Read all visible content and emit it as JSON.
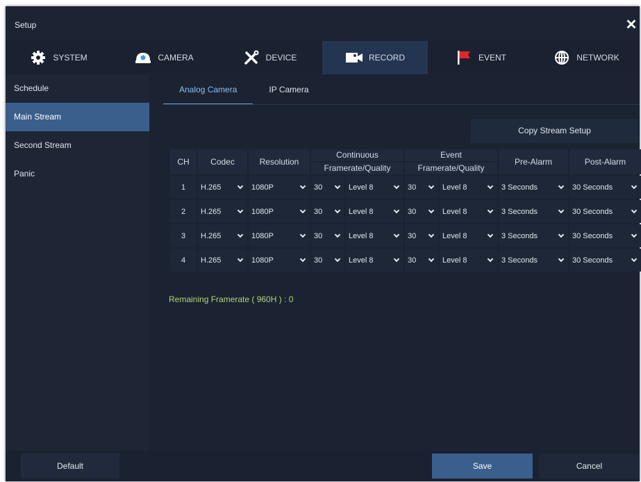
{
  "window": {
    "title": "Setup"
  },
  "tabs": [
    {
      "label": "SYSTEM",
      "icon": "gear-icon"
    },
    {
      "label": "CAMERA",
      "icon": "camera-icon"
    },
    {
      "label": "DEVICE",
      "icon": "tools-icon"
    },
    {
      "label": "RECORD",
      "icon": "video-camera-icon"
    },
    {
      "label": "EVENT",
      "icon": "flag-icon"
    },
    {
      "label": "NETWORK",
      "icon": "globe-icon"
    }
  ],
  "active_tab": "RECORD",
  "sidebar": {
    "items": [
      {
        "label": "Schedule"
      },
      {
        "label": "Main Stream"
      },
      {
        "label": "Second Stream"
      },
      {
        "label": "Panic"
      }
    ],
    "active": "Main Stream"
  },
  "subtabs": [
    {
      "label": "Analog Camera"
    },
    {
      "label": "IP Camera"
    }
  ],
  "active_subtab": "Analog Camera",
  "copy_button": "Copy Stream Setup",
  "table": {
    "headers": {
      "ch": "CH",
      "codec": "Codec",
      "resolution": "Resolution",
      "continuous": "Continuous",
      "event": "Event",
      "framerate_quality": "Framerate/Quality",
      "pre_alarm": "Pre-Alarm",
      "post_alarm": "Post-Alarm"
    },
    "rows": [
      {
        "ch": "1",
        "codec": "H.265",
        "resolution": "1080P",
        "cont_fps": "30",
        "cont_quality": "Level 8",
        "event_fps": "30",
        "event_quality": "Level 8",
        "pre_alarm": "3 Seconds",
        "post_alarm": "30 Seconds"
      },
      {
        "ch": "2",
        "codec": "H.265",
        "resolution": "1080P",
        "cont_fps": "30",
        "cont_quality": "Level 8",
        "event_fps": "30",
        "event_quality": "Level 8",
        "pre_alarm": "3 Seconds",
        "post_alarm": "30 Seconds"
      },
      {
        "ch": "3",
        "codec": "H.265",
        "resolution": "1080P",
        "cont_fps": "30",
        "cont_quality": "Level 8",
        "event_fps": "30",
        "event_quality": "Level 8",
        "pre_alarm": "3 Seconds",
        "post_alarm": "30 Seconds"
      },
      {
        "ch": "4",
        "codec": "H.265",
        "resolution": "1080P",
        "cont_fps": "30",
        "cont_quality": "Level 8",
        "event_fps": "30",
        "event_quality": "Level 8",
        "pre_alarm": "3 Seconds",
        "post_alarm": "30 Seconds"
      }
    ]
  },
  "remaining_text": "Remaining Framerate ( 960H ) : 0",
  "footer": {
    "default": "Default",
    "save": "Save",
    "cancel": "Cancel"
  },
  "colors": {
    "accent": "#3a5f8c",
    "active_tab": "#243552",
    "link": "#8cc0f0",
    "remaining": "#b6d47a"
  }
}
